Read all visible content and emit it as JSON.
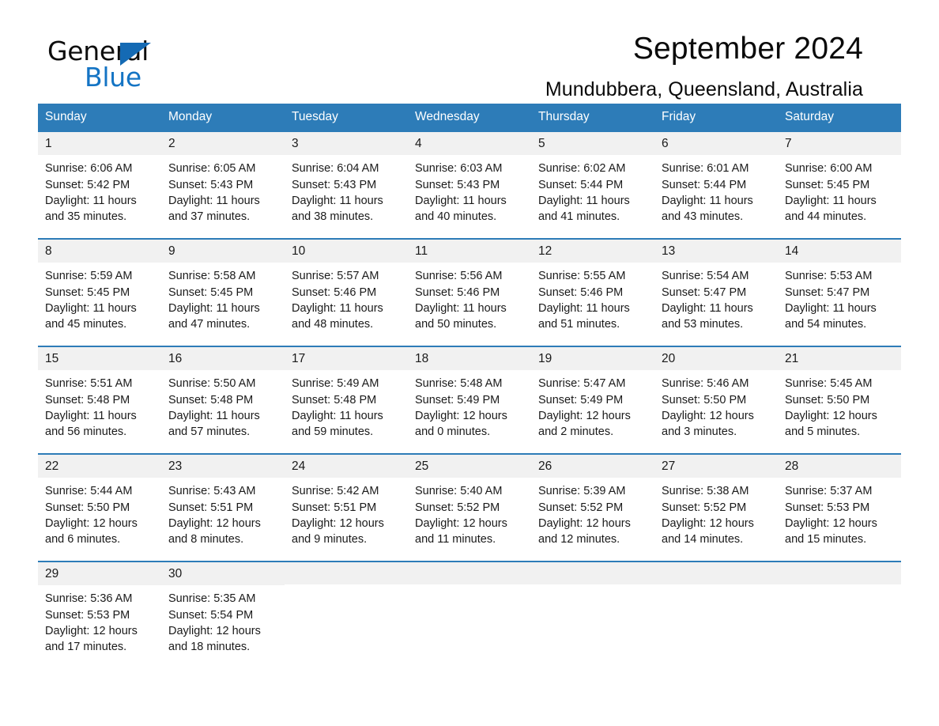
{
  "brand": {
    "name_dark": "General",
    "name_light": "Blue",
    "triangle_color": "#146ab4",
    "accent_color": "#2d7cb8"
  },
  "header": {
    "title": "September 2024",
    "subtitle": "Mundubbera, Queensland, Australia"
  },
  "calendar": {
    "weekday_headers": [
      "Sunday",
      "Monday",
      "Tuesday",
      "Wednesday",
      "Thursday",
      "Friday",
      "Saturday"
    ],
    "weeks": [
      [
        {
          "day": "1",
          "sunrise": "Sunrise: 6:06 AM",
          "sunset": "Sunset: 5:42 PM",
          "daylight_line1": "Daylight: 11 hours",
          "daylight_line2": "and 35 minutes."
        },
        {
          "day": "2",
          "sunrise": "Sunrise: 6:05 AM",
          "sunset": "Sunset: 5:43 PM",
          "daylight_line1": "Daylight: 11 hours",
          "daylight_line2": "and 37 minutes."
        },
        {
          "day": "3",
          "sunrise": "Sunrise: 6:04 AM",
          "sunset": "Sunset: 5:43 PM",
          "daylight_line1": "Daylight: 11 hours",
          "daylight_line2": "and 38 minutes."
        },
        {
          "day": "4",
          "sunrise": "Sunrise: 6:03 AM",
          "sunset": "Sunset: 5:43 PM",
          "daylight_line1": "Daylight: 11 hours",
          "daylight_line2": "and 40 minutes."
        },
        {
          "day": "5",
          "sunrise": "Sunrise: 6:02 AM",
          "sunset": "Sunset: 5:44 PM",
          "daylight_line1": "Daylight: 11 hours",
          "daylight_line2": "and 41 minutes."
        },
        {
          "day": "6",
          "sunrise": "Sunrise: 6:01 AM",
          "sunset": "Sunset: 5:44 PM",
          "daylight_line1": "Daylight: 11 hours",
          "daylight_line2": "and 43 minutes."
        },
        {
          "day": "7",
          "sunrise": "Sunrise: 6:00 AM",
          "sunset": "Sunset: 5:45 PM",
          "daylight_line1": "Daylight: 11 hours",
          "daylight_line2": "and 44 minutes."
        }
      ],
      [
        {
          "day": "8",
          "sunrise": "Sunrise: 5:59 AM",
          "sunset": "Sunset: 5:45 PM",
          "daylight_line1": "Daylight: 11 hours",
          "daylight_line2": "and 45 minutes."
        },
        {
          "day": "9",
          "sunrise": "Sunrise: 5:58 AM",
          "sunset": "Sunset: 5:45 PM",
          "daylight_line1": "Daylight: 11 hours",
          "daylight_line2": "and 47 minutes."
        },
        {
          "day": "10",
          "sunrise": "Sunrise: 5:57 AM",
          "sunset": "Sunset: 5:46 PM",
          "daylight_line1": "Daylight: 11 hours",
          "daylight_line2": "and 48 minutes."
        },
        {
          "day": "11",
          "sunrise": "Sunrise: 5:56 AM",
          "sunset": "Sunset: 5:46 PM",
          "daylight_line1": "Daylight: 11 hours",
          "daylight_line2": "and 50 minutes."
        },
        {
          "day": "12",
          "sunrise": "Sunrise: 5:55 AM",
          "sunset": "Sunset: 5:46 PM",
          "daylight_line1": "Daylight: 11 hours",
          "daylight_line2": "and 51 minutes."
        },
        {
          "day": "13",
          "sunrise": "Sunrise: 5:54 AM",
          "sunset": "Sunset: 5:47 PM",
          "daylight_line1": "Daylight: 11 hours",
          "daylight_line2": "and 53 minutes."
        },
        {
          "day": "14",
          "sunrise": "Sunrise: 5:53 AM",
          "sunset": "Sunset: 5:47 PM",
          "daylight_line1": "Daylight: 11 hours",
          "daylight_line2": "and 54 minutes."
        }
      ],
      [
        {
          "day": "15",
          "sunrise": "Sunrise: 5:51 AM",
          "sunset": "Sunset: 5:48 PM",
          "daylight_line1": "Daylight: 11 hours",
          "daylight_line2": "and 56 minutes."
        },
        {
          "day": "16",
          "sunrise": "Sunrise: 5:50 AM",
          "sunset": "Sunset: 5:48 PM",
          "daylight_line1": "Daylight: 11 hours",
          "daylight_line2": "and 57 minutes."
        },
        {
          "day": "17",
          "sunrise": "Sunrise: 5:49 AM",
          "sunset": "Sunset: 5:48 PM",
          "daylight_line1": "Daylight: 11 hours",
          "daylight_line2": "and 59 minutes."
        },
        {
          "day": "18",
          "sunrise": "Sunrise: 5:48 AM",
          "sunset": "Sunset: 5:49 PM",
          "daylight_line1": "Daylight: 12 hours",
          "daylight_line2": "and 0 minutes."
        },
        {
          "day": "19",
          "sunrise": "Sunrise: 5:47 AM",
          "sunset": "Sunset: 5:49 PM",
          "daylight_line1": "Daylight: 12 hours",
          "daylight_line2": "and 2 minutes."
        },
        {
          "day": "20",
          "sunrise": "Sunrise: 5:46 AM",
          "sunset": "Sunset: 5:50 PM",
          "daylight_line1": "Daylight: 12 hours",
          "daylight_line2": "and 3 minutes."
        },
        {
          "day": "21",
          "sunrise": "Sunrise: 5:45 AM",
          "sunset": "Sunset: 5:50 PM",
          "daylight_line1": "Daylight: 12 hours",
          "daylight_line2": "and 5 minutes."
        }
      ],
      [
        {
          "day": "22",
          "sunrise": "Sunrise: 5:44 AM",
          "sunset": "Sunset: 5:50 PM",
          "daylight_line1": "Daylight: 12 hours",
          "daylight_line2": "and 6 minutes."
        },
        {
          "day": "23",
          "sunrise": "Sunrise: 5:43 AM",
          "sunset": "Sunset: 5:51 PM",
          "daylight_line1": "Daylight: 12 hours",
          "daylight_line2": "and 8 minutes."
        },
        {
          "day": "24",
          "sunrise": "Sunrise: 5:42 AM",
          "sunset": "Sunset: 5:51 PM",
          "daylight_line1": "Daylight: 12 hours",
          "daylight_line2": "and 9 minutes."
        },
        {
          "day": "25",
          "sunrise": "Sunrise: 5:40 AM",
          "sunset": "Sunset: 5:52 PM",
          "daylight_line1": "Daylight: 12 hours",
          "daylight_line2": "and 11 minutes."
        },
        {
          "day": "26",
          "sunrise": "Sunrise: 5:39 AM",
          "sunset": "Sunset: 5:52 PM",
          "daylight_line1": "Daylight: 12 hours",
          "daylight_line2": "and 12 minutes."
        },
        {
          "day": "27",
          "sunrise": "Sunrise: 5:38 AM",
          "sunset": "Sunset: 5:52 PM",
          "daylight_line1": "Daylight: 12 hours",
          "daylight_line2": "and 14 minutes."
        },
        {
          "day": "28",
          "sunrise": "Sunrise: 5:37 AM",
          "sunset": "Sunset: 5:53 PM",
          "daylight_line1": "Daylight: 12 hours",
          "daylight_line2": "and 15 minutes."
        }
      ],
      [
        {
          "day": "29",
          "sunrise": "Sunrise: 5:36 AM",
          "sunset": "Sunset: 5:53 PM",
          "daylight_line1": "Daylight: 12 hours",
          "daylight_line2": "and 17 minutes."
        },
        {
          "day": "30",
          "sunrise": "Sunrise: 5:35 AM",
          "sunset": "Sunset: 5:54 PM",
          "daylight_line1": "Daylight: 12 hours",
          "daylight_line2": "and 18 minutes."
        },
        {
          "day": "",
          "sunrise": "",
          "sunset": "",
          "daylight_line1": "",
          "daylight_line2": ""
        },
        {
          "day": "",
          "sunrise": "",
          "sunset": "",
          "daylight_line1": "",
          "daylight_line2": ""
        },
        {
          "day": "",
          "sunrise": "",
          "sunset": "",
          "daylight_line1": "",
          "daylight_line2": ""
        },
        {
          "day": "",
          "sunrise": "",
          "sunset": "",
          "daylight_line1": "",
          "daylight_line2": ""
        },
        {
          "day": "",
          "sunrise": "",
          "sunset": "",
          "daylight_line1": "",
          "daylight_line2": ""
        }
      ]
    ]
  }
}
